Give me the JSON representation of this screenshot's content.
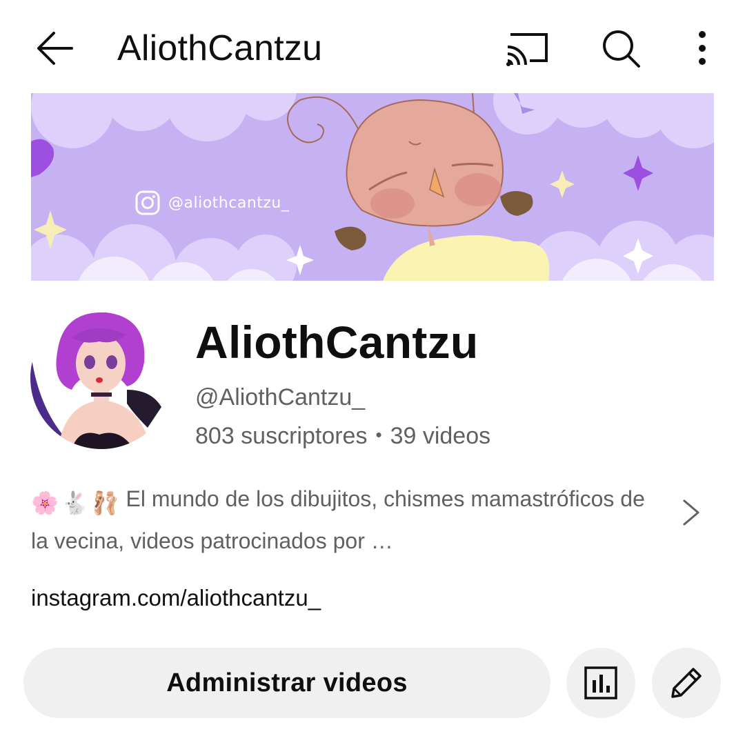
{
  "topbar": {
    "title": "AliothCantzu",
    "icons": [
      "back-arrow-icon",
      "cast-icon",
      "search-icon",
      "more-vert-icon"
    ]
  },
  "banner": {
    "instagram_handle": "@aliothcantzu_",
    "colors": {
      "background": "#c6b1f3",
      "clouds": "#ddd0fa"
    }
  },
  "channel": {
    "name": "AliothCantzu",
    "handle": "@AliothCantzu_",
    "subscribers": "803 suscriptores",
    "separator": "•",
    "videos": "39 videos"
  },
  "description": {
    "emojis": [
      "🌸",
      "🐇",
      "🩰"
    ],
    "text": "El mundo de los dibujitos, chismes mamastróficos de la vecina, videos patrocinados por …"
  },
  "link": "instagram.com/aliothcantzu_",
  "actions": {
    "manage_label": "Administrar videos",
    "icons": [
      "analytics-icon",
      "edit-pencil-icon"
    ]
  }
}
